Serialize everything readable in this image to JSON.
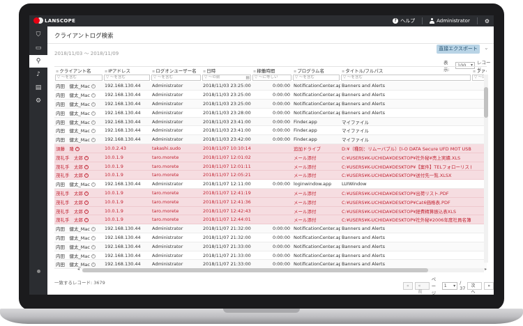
{
  "app": {
    "brand": "LANSCOPE",
    "help_label": "ヘルプ",
    "user_label": "Administrator"
  },
  "sidebar": {
    "items": [
      {
        "name": "shield-icon",
        "glyph": "⛉"
      },
      {
        "name": "monitor-icon",
        "glyph": "▭"
      },
      {
        "name": "search-icon",
        "glyph": "⚲"
      },
      {
        "name": "bell-icon",
        "glyph": "♪"
      },
      {
        "name": "report-icon",
        "glyph": "▤"
      },
      {
        "name": "gear-icon",
        "glyph": "⚙"
      }
    ]
  },
  "page": {
    "title": "クライアントログ検索",
    "date_range": "2018/11/03 〜 2018/11/09",
    "export_label": "直接エクスポート",
    "page_size_label": "表示:",
    "page_size_value": "100",
    "page_size_unit": "レコード"
  },
  "table": {
    "columns": [
      "クライアント名",
      "IPアドレス",
      "ログオンユーザー名",
      "日時",
      "稼働時間",
      "プログラム名",
      "タイトル/フルパス",
      "ファイル"
    ],
    "filters": [
      "▽ ～を含む",
      "▽ ～を含む",
      "▽ ～を含む",
      "▽ ～の前",
      "▽ ～に等しい",
      "▽ ～を含む",
      "▽ ～を含む",
      "▽ ～に"
    ],
    "rows": [
      {
        "client": "内田　健太_Mac",
        "ip": "192.168.130.44",
        "user": "Administrator",
        "datetime": "2018/11/03 23:25:00",
        "uptime": "0:00:00",
        "program": "NotificationCenter.app",
        "title": "Banners and Alerts",
        "alert": false
      },
      {
        "client": "内田　健太_Mac",
        "ip": "192.168.130.44",
        "user": "Administrator",
        "datetime": "2018/11/03 23:25:00",
        "uptime": "0:00:00",
        "program": "NotificationCenter.app",
        "title": "Banners and Alerts",
        "alert": false
      },
      {
        "client": "内田　健太_Mac",
        "ip": "192.168.130.44",
        "user": "Administrator",
        "datetime": "2018/11/03 23:25:00",
        "uptime": "0:00:00",
        "program": "NotificationCenter.app",
        "title": "Banners and Alerts",
        "alert": false
      },
      {
        "client": "内田　健太_Mac",
        "ip": "192.168.130.44",
        "user": "Administrator",
        "datetime": "2018/11/03 23:28:00",
        "uptime": "0:00:00",
        "program": "NotificationCenter.app",
        "title": "Banners and Alerts",
        "alert": false
      },
      {
        "client": "内田　健太_Mac",
        "ip": "192.168.130.44",
        "user": "Administrator",
        "datetime": "2018/11/03 23:41:00",
        "uptime": "0:00:00",
        "program": "Finder.app",
        "title": "マイファイル",
        "alert": false
      },
      {
        "client": "内田　健太_Mac",
        "ip": "192.168.130.44",
        "user": "Administrator",
        "datetime": "2018/11/03 23:41:00",
        "uptime": "0:00:00",
        "program": "Finder.app",
        "title": "マイファイル",
        "alert": false
      },
      {
        "client": "内田　健太_Mac",
        "ip": "192.168.130.44",
        "user": "Administrator",
        "datetime": "2018/11/03 23:42:00",
        "uptime": "0:00:00",
        "program": "Finder.app",
        "title": "マイファイル",
        "alert": false
      },
      {
        "client": "須藤　隆",
        "ip": "10.0.2.43",
        "user": "takashi.sudo",
        "datetime": "2018/11/07 10:10:14",
        "uptime": "",
        "program": "追加ドライブ",
        "title": "D:¥（種別：リムーバブル）[I-O DATA Secure UFD MOT USB…",
        "alert": true
      },
      {
        "client": "茂礼手　太郎",
        "ip": "10.0.1.9",
        "user": "taro.morete",
        "datetime": "2018/11/07 12:01:02",
        "uptime": "",
        "program": "メール添付",
        "title": "C:¥USERS¥K-UCHIDA¥DESKTOP¥社外秘¥売上実績.XLS",
        "alert": true
      },
      {
        "client": "茂礼手　太郎",
        "ip": "10.0.1.9",
        "user": "taro.morete",
        "datetime": "2018/11/07 12:01:11",
        "uptime": "",
        "program": "メール添付",
        "title": "C:¥USERS¥K-UCHIDA¥DESKTOP¥【案件】TELフォローリスト…",
        "alert": true
      },
      {
        "client": "茂礼手　太郎",
        "ip": "10.0.1.9",
        "user": "taro.morete",
        "datetime": "2018/11/07 12:05:21",
        "uptime": "",
        "program": "メール添付",
        "title": "C:¥USERS¥K-UCHIDA¥DESKTOP¥送付先一覧.XLSX",
        "alert": true
      },
      {
        "client": "内田　健太_Mac",
        "ip": "192.168.130.44",
        "user": "Administrator",
        "datetime": "2018/11/07 12:11:00",
        "uptime": "0:00:00",
        "program": "loginwindow.app",
        "title": "LUIWindow",
        "alert": false
      },
      {
        "client": "茂礼手　太郎",
        "ip": "10.0.1.9",
        "user": "taro.morete",
        "datetime": "2018/11/07 12:41:19",
        "uptime": "",
        "program": "メール添付",
        "title": "C:¥USERS¥K-UCHIDA¥DESKTOP¥出荷リスト.PDF",
        "alert": true
      },
      {
        "client": "茂礼手　太郎",
        "ip": "10.0.1.9",
        "user": "taro.morete",
        "datetime": "2018/11/07 12:41:36",
        "uptime": "",
        "program": "メール添付",
        "title": "C:¥USERS¥K-UCHIDA¥DESKTOP¥Cat6価格表.PDF",
        "alert": true
      },
      {
        "client": "茂礼手　太郎",
        "ip": "10.0.1.9",
        "user": "taro.morete",
        "datetime": "2018/11/07 12:42:43",
        "uptime": "",
        "program": "メール添付",
        "title": "C:¥USERS¥K-UCHIDA¥DESKTOP¥経費精算振込表XLS",
        "alert": true
      },
      {
        "client": "茂礼手　太郎",
        "ip": "10.0.1.9",
        "user": "taro.morete",
        "datetime": "2018/11/07 12:44:01",
        "uptime": "",
        "program": "メール添付",
        "title": "C:¥USERS¥K-UCHIDA¥DESKTOP¥社外秘¥2006年度社員名簿…",
        "alert": true
      },
      {
        "client": "内田　健太_Mac",
        "ip": "192.168.130.44",
        "user": "Administrator",
        "datetime": "2018/11/07 21:32:00",
        "uptime": "0:00:00",
        "program": "NotificationCenter.app",
        "title": "Banners and Alerts",
        "alert": false
      },
      {
        "client": "内田　健太_Mac",
        "ip": "192.168.130.44",
        "user": "Administrator",
        "datetime": "2018/11/07 21:32:00",
        "uptime": "0:00:00",
        "program": "NotificationCenter.app",
        "title": "Banners and Alerts",
        "alert": false
      },
      {
        "client": "内田　健太_Mac",
        "ip": "192.168.130.44",
        "user": "Administrator",
        "datetime": "2018/11/07 21:33:00",
        "uptime": "0:00:00",
        "program": "NotificationCenter.app",
        "title": "Banners and Alerts",
        "alert": false
      },
      {
        "client": "内田　健太_Mac",
        "ip": "192.168.130.44",
        "user": "Administrator",
        "datetime": "2018/11/07 21:33:00",
        "uptime": "0:00:00",
        "program": "NotificationCenter.app",
        "title": "Banners and Alerts",
        "alert": false
      },
      {
        "client": "内田　健太_Mac",
        "ip": "192.168.130.44",
        "user": "Administrator",
        "datetime": "2018/11/07 21:33:00",
        "uptime": "0:00:00",
        "program": "NotificationCenter.app",
        "title": "Banners and Alerts",
        "alert": false
      }
    ]
  },
  "footer": {
    "record_count": "一致するレコード: 3679",
    "prev_page": "« 前へ",
    "first_page": "«",
    "page_label": "ページ",
    "page_value": "1",
    "total_pages": "/ 37",
    "next_page": "次へ »",
    "last_page": "»"
  },
  "colors": {
    "sidebar": "#2b2d31",
    "alert_row": "#f6dde1",
    "alert_text": "#c12332",
    "accent": "#b9d4e6"
  }
}
